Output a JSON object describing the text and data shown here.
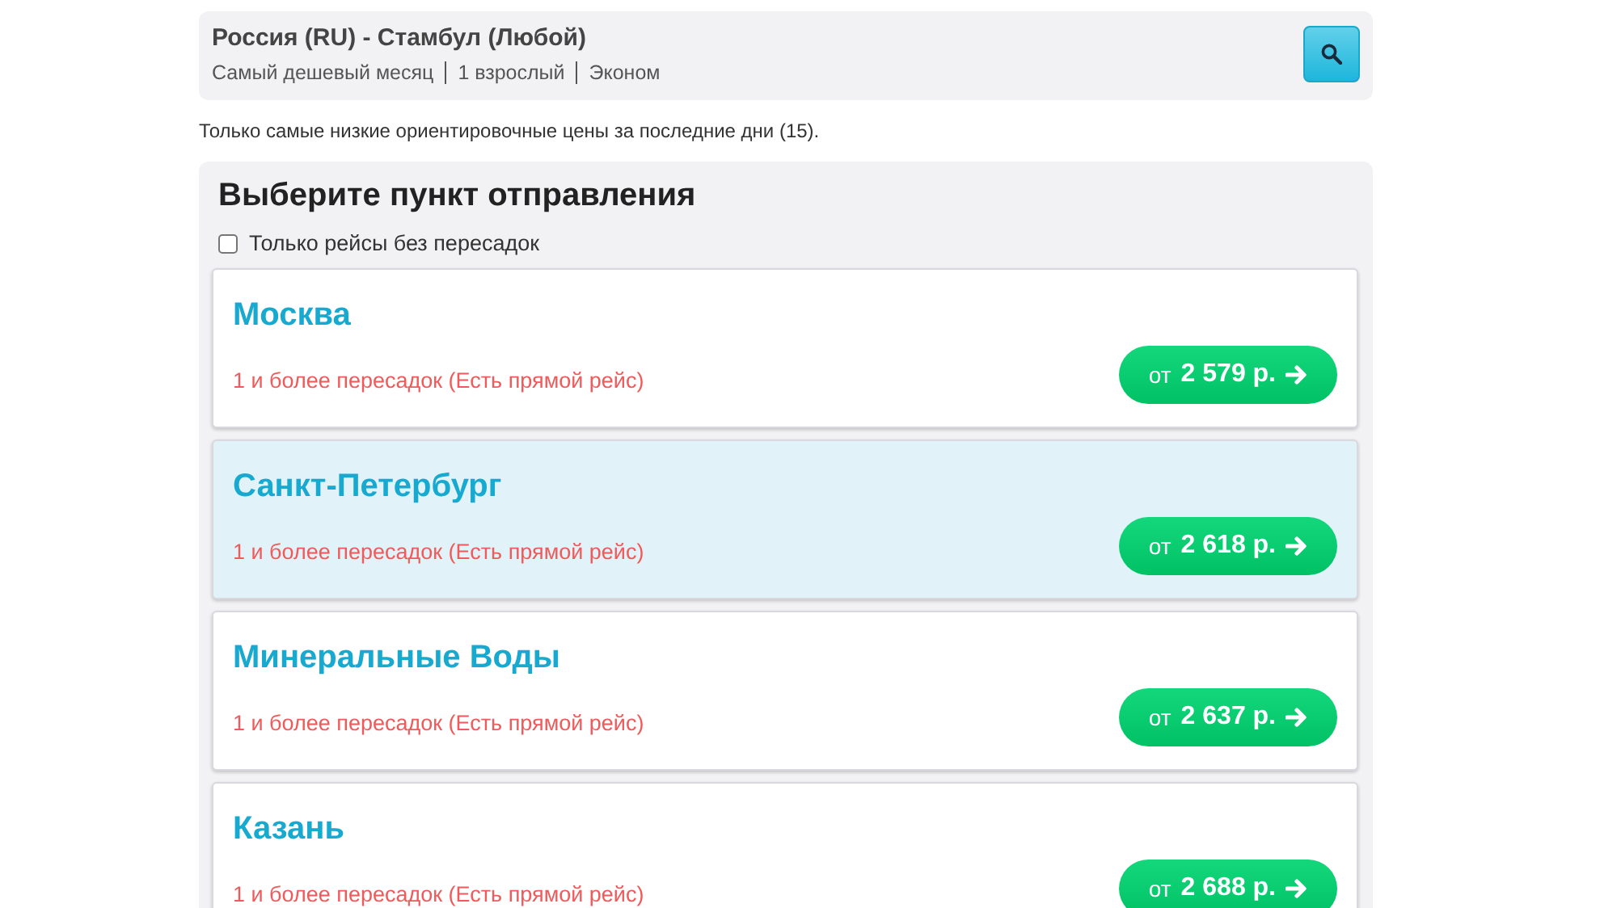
{
  "search_summary": {
    "route": "Россия (RU) - Стамбул (Любой)",
    "details": [
      "Самый дешевый месяц",
      "1 взрослый",
      "Эконом"
    ]
  },
  "note": "Только самые низкие ориентировочные цены за последние дни (15).",
  "panel": {
    "title": "Выберите пункт отправления",
    "direct_only": {
      "label": "Только рейсы без пересадок",
      "checked": false
    },
    "destinations": [
      {
        "city": "Москва",
        "stops": "1 и более пересадок (Есть прямой рейс)",
        "price_prefix": "от",
        "price": "2 579 р.",
        "highlighted": false
      },
      {
        "city": "Санкт-Петербург",
        "stops": "1 и более пересадок (Есть прямой рейс)",
        "price_prefix": "от",
        "price": "2 618 р.",
        "highlighted": true
      },
      {
        "city": "Минеральные Воды",
        "stops": "1 и более пересадок (Есть прямой рейс)",
        "price_prefix": "от",
        "price": "2 637 р.",
        "highlighted": false
      },
      {
        "city": "Казань",
        "stops": "1 и более пересадок (Есть прямой рейс)",
        "price_prefix": "от",
        "price": "2 688 р.",
        "highlighted": false
      }
    ]
  }
}
